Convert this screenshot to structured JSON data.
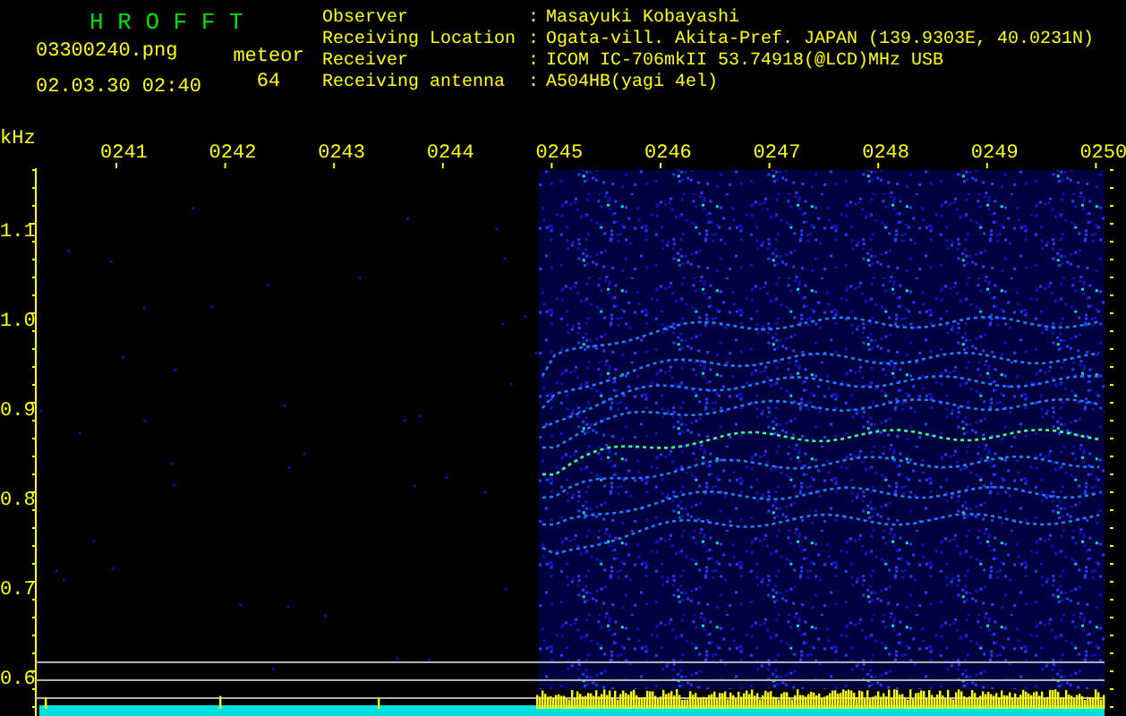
{
  "title": "H R O F F T",
  "file_name": "03300240.png",
  "timestamp": "02.03.30 02:40",
  "meteor": {
    "label": "meteor",
    "count": "64"
  },
  "info": [
    {
      "label": "Observer",
      "separator": ":",
      "value": "Masayuki Kobayashi"
    },
    {
      "label": "Receiving Location",
      "separator": ":",
      "value": "Ogata-vill. Akita-Pref. JAPAN (139.9303E, 40.0231N)"
    },
    {
      "label": "Receiver",
      "separator": ":",
      "value": "ICOM IC-706mkII 53.74918(@LCD)MHz USB"
    },
    {
      "label": "Receiving antenna",
      "separator": ":",
      "value": "A504HB(yagi 4el)"
    }
  ],
  "y_axis": {
    "unit": "kHz",
    "labels": [
      "1.1",
      "1.0",
      "0.9",
      "0.8",
      "0.7",
      "0.6"
    ]
  },
  "x_axis": {
    "labels": [
      "0241",
      "0242",
      "0243",
      "0244",
      "0245",
      "0246",
      "0247",
      "0248",
      "0249",
      "0250"
    ]
  }
}
